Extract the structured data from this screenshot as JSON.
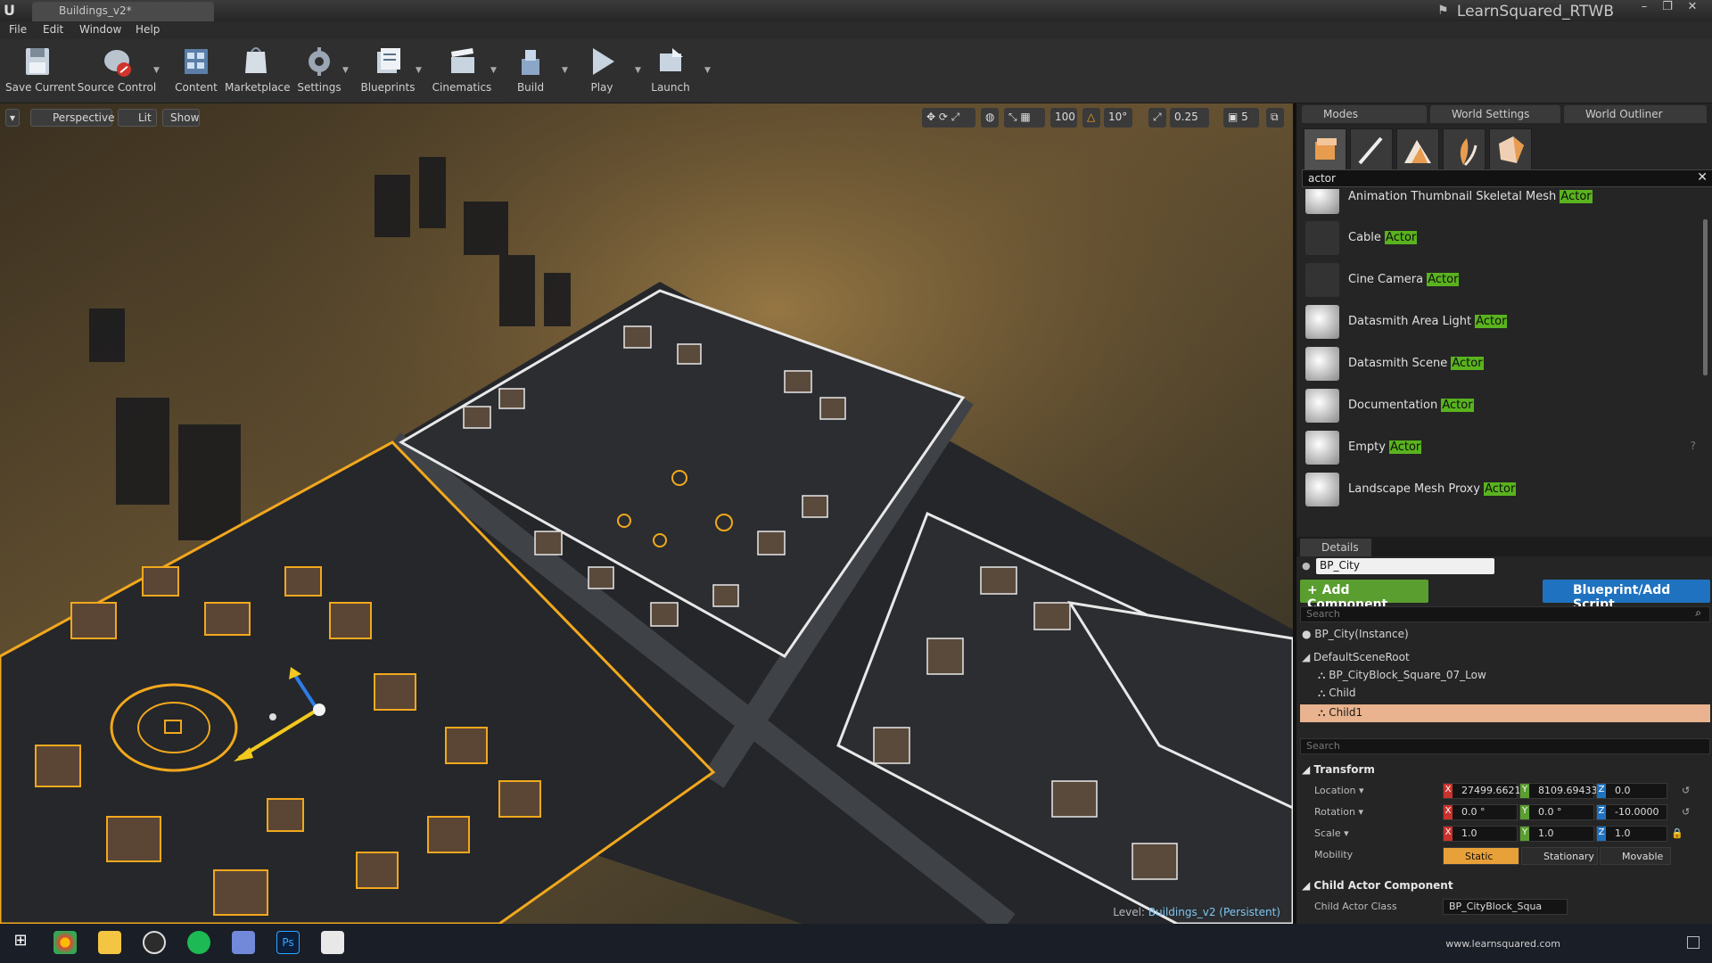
{
  "title_bar": {
    "tab_title": "Buildings_v2*",
    "project_name": "LearnSquared_RTWB"
  },
  "menu": [
    "File",
    "Edit",
    "Window",
    "Help"
  ],
  "toolbar": {
    "buttons": [
      "Save Current",
      "Source Control",
      "Content",
      "Marketplace",
      "Settings",
      "Blueprints",
      "Cinematics",
      "Build",
      "Play",
      "Launch"
    ]
  },
  "viewport": {
    "view_mode": "Perspective",
    "lit_label": "Lit",
    "show_label": "Show",
    "grid_snap": "100",
    "rotation_snap": "10°",
    "scale_snap": "0.25",
    "camera_speed": "5",
    "level_prefix": "Level:",
    "level_name": "Buildings_v2 (Persistent)"
  },
  "panels": {
    "tabs": [
      "Modes",
      "World Settings",
      "World Outliner"
    ],
    "search_value": "actor",
    "actors": [
      {
        "name": "Animation Thumbnail Skeletal Mesh",
        "tag": "Actor"
      },
      {
        "name": "Cable",
        "tag": "Actor"
      },
      {
        "name": "Cine Camera",
        "tag": "Actor"
      },
      {
        "name": "Datasmith Area Light",
        "tag": "Actor"
      },
      {
        "name": "Datasmith Scene",
        "tag": "Actor"
      },
      {
        "name": "Documentation",
        "tag": "Actor"
      },
      {
        "name": "Empty",
        "tag": "Actor"
      },
      {
        "name": "Landscape Mesh Proxy",
        "tag": "Actor"
      }
    ]
  },
  "details": {
    "tab": "Details",
    "actor_name": "BP_City",
    "add_component": "+ Add Component",
    "blueprint_script": "Blueprint/Add Script",
    "search_placeholder": "Search",
    "instance": "BP_City(Instance)",
    "tree": [
      "DefaultSceneRoot",
      "BP_CityBlock_Square_07_Low",
      "Child",
      "Child1"
    ],
    "search2_placeholder": "Search",
    "transform_label": "Transform",
    "location_label": "Location",
    "rotation_label": "Rotation",
    "scale_label": "Scale",
    "mobility_label": "Mobility",
    "location": [
      "27499.6621",
      "8109.69433",
      "0.0"
    ],
    "rotation": [
      "0.0 °",
      "0.0 °",
      "-10.0000"
    ],
    "scale": [
      "1.0",
      "1.0",
      "1.0"
    ],
    "mobility": [
      "Static",
      "Stationary",
      "Movable"
    ],
    "child_section": "Child Actor Component",
    "child_class_label": "Child Actor Class",
    "child_class_value": "BP_CityBlock_Squa"
  },
  "taskbar": {
    "tray_text": "www.learnsquared.com"
  },
  "colors": {
    "selection_orange": "#f2a81d",
    "accent_green": "#5ab31e",
    "accent_blue": "#1f72c0"
  }
}
